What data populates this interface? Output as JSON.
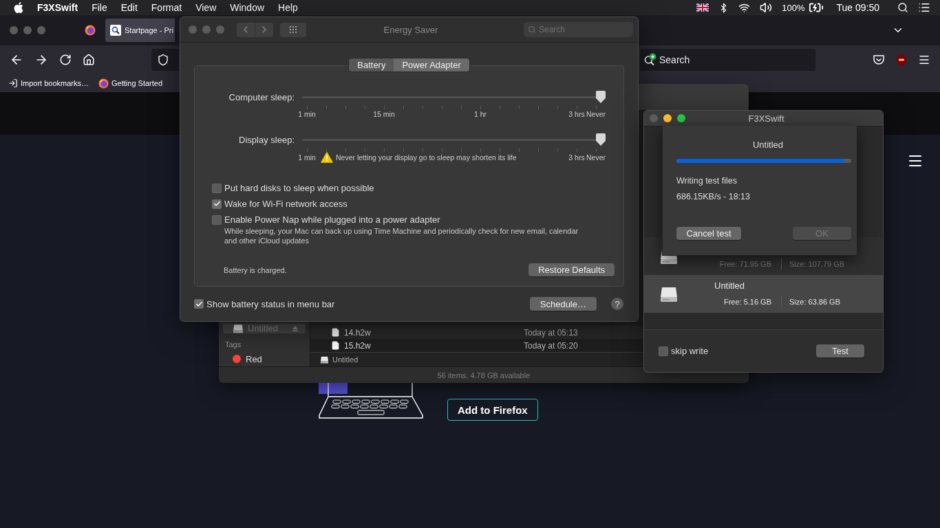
{
  "menu_bar": {
    "app_name": "F3XSwift",
    "menus": [
      "File",
      "Edit",
      "Format",
      "View",
      "Window",
      "Help"
    ],
    "battery": "100%",
    "clock": "Tue 09:50"
  },
  "browser": {
    "tabs": [
      {
        "title": "Startpage - Pri",
        "selected": true
      }
    ],
    "search": {
      "placeholder": "Search"
    },
    "bookmarks": [
      {
        "label": "Import bookmarks…",
        "kind": "import"
      },
      {
        "label": "Getting Started",
        "kind": "firefox"
      }
    ],
    "page": {
      "button": "Add to Firefox"
    }
  },
  "finder": {
    "sidebar": [
      {
        "label": "Untitled",
        "selected": true
      }
    ],
    "tags_heading": "Tags",
    "tags": [
      {
        "label": "Red",
        "color": "#ff453a"
      }
    ],
    "files": [
      {
        "name": "14.h2w",
        "date": "Today at 05:13"
      },
      {
        "name": "15.h2w",
        "date": "Today at 05:20"
      }
    ],
    "path": "Untitled",
    "status": "56 items, 4.78 GB available"
  },
  "energy_saver": {
    "title": "Energy Saver",
    "search": {
      "placeholder": "Search"
    },
    "tabs": [
      {
        "label": "Battery",
        "selected": false
      },
      {
        "label": "Power Adapter",
        "selected": true
      }
    ],
    "sliders": [
      {
        "label": "Computer sleep:",
        "level": 1,
        "scale": [
          "1 min",
          "15 min",
          "1 hr",
          "3 hrs",
          "Never"
        ]
      },
      {
        "label": "Display sleep:",
        "level": 1,
        "scale": [
          "1 min",
          "3 hrs",
          "Never"
        ],
        "warning": "Never letting your display go to sleep may shorten its life"
      }
    ],
    "options": [
      {
        "label": "Put hard disks to sleep when possible",
        "checked": false
      },
      {
        "label": "Wake for Wi-Fi network access",
        "checked": true
      },
      {
        "label": "Enable Power Nap while plugged into a power adapter",
        "checked": false,
        "note": "While sleeping, your Mac can back up using Time Machine and periodically check for new email, calendar and other iCloud updates"
      }
    ],
    "status": "Battery is charged.",
    "restore_button": "Restore Defaults",
    "show_battery_status": {
      "label": "Show battery status in menu bar",
      "checked": true
    },
    "schedule_button": "Schedule…",
    "help_button": "?"
  },
  "f3xswift": {
    "title": "F3XSwift",
    "disks": [
      {
        "free": "Free: 71.95 GB",
        "size": "Size: 107.79 GB",
        "selected": false
      },
      {
        "name": "Untitled",
        "free": "Free: 5.16 GB",
        "size": "Size: 63.86 GB",
        "selected": true
      }
    ],
    "skip_write": {
      "label": "skip write",
      "checked": false
    },
    "test_button": "Test",
    "sheet": {
      "title": "Untitled",
      "level": 0.96,
      "status": "Writing test files",
      "speed": "686.15KB/s - 18:13",
      "cancel_button": "Cancel test",
      "ok_button": {
        "label": "OK",
        "disabled": true
      }
    }
  }
}
